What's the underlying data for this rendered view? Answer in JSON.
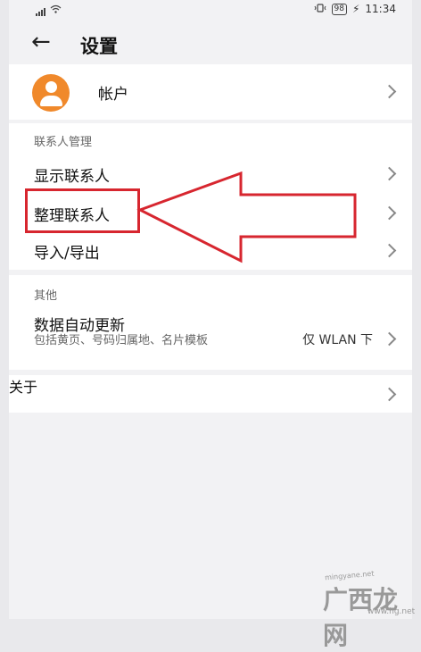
{
  "status_bar": {
    "battery": "98",
    "time": "11:34",
    "icons": [
      "signal-icon",
      "wifi-icon",
      "vibrate-icon",
      "battery-icon",
      "charging-icon"
    ]
  },
  "header": {
    "back_icon": "back-arrow-icon",
    "title": "设置"
  },
  "account": {
    "label": "帐户"
  },
  "contacts_section": {
    "title": "联系人管理",
    "items": [
      {
        "label": "显示联系人"
      },
      {
        "label": "整理联系人"
      },
      {
        "label": "导入/导出"
      }
    ]
  },
  "other_section": {
    "title": "其他",
    "auto_update": {
      "label": "数据自动更新",
      "description": "包括黄页、号码归属地、名片模板",
      "value": "仅 WLAN 下"
    }
  },
  "about": {
    "label": "关于"
  },
  "annotation": {
    "color": "#d7262f"
  },
  "watermark": {
    "small": "mingyane.net",
    "big": "广西龙网",
    "url": "www.hg.net"
  }
}
